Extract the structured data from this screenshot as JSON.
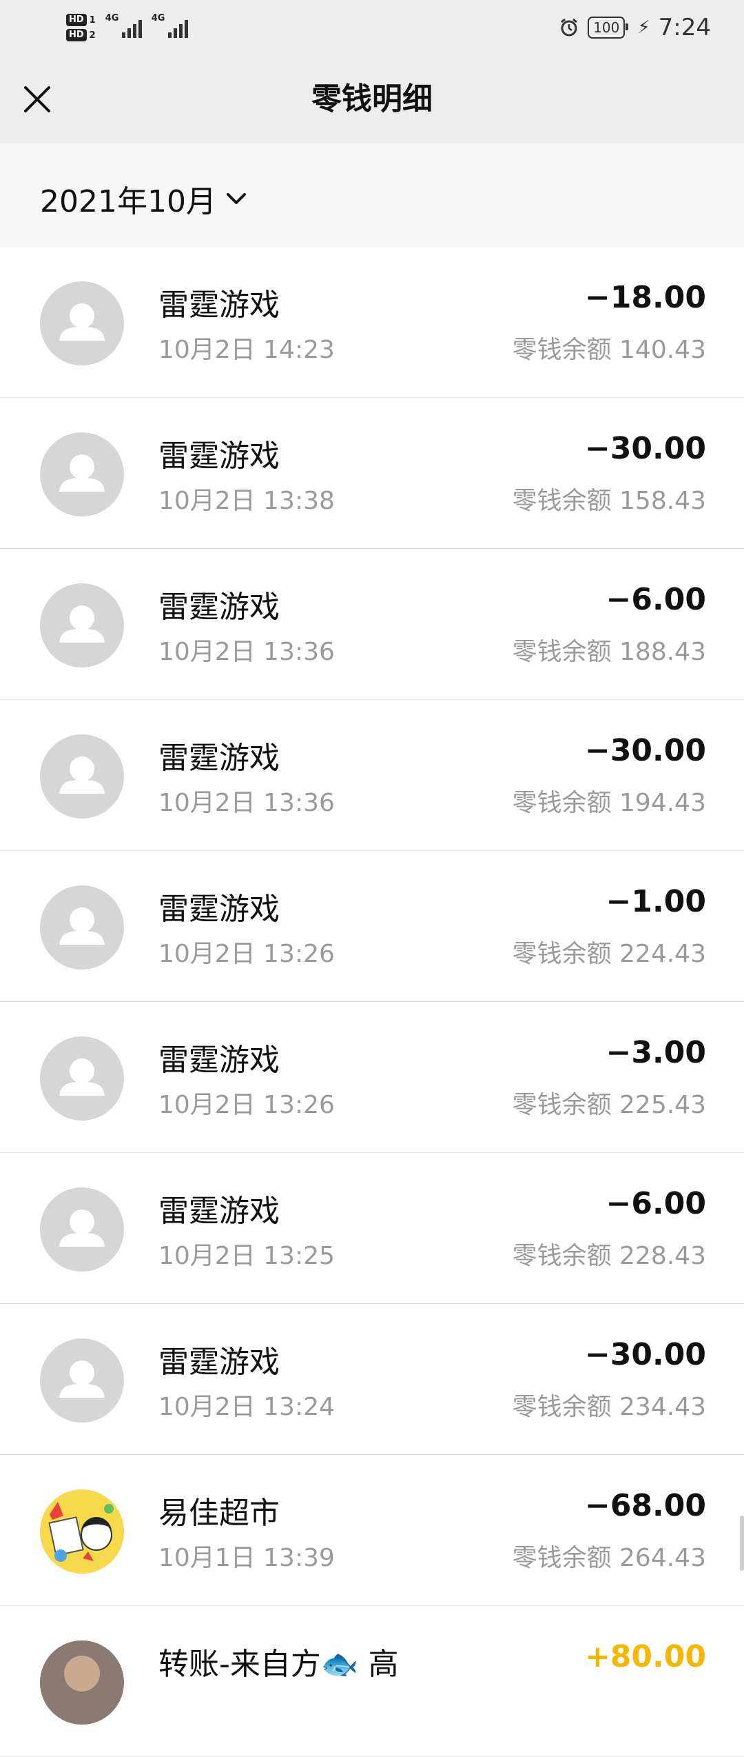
{
  "status_bar": {
    "sim1_badge": "HD",
    "sim1_num": "1",
    "sim2_badge": "HD",
    "sim2_num": "2",
    "network1": "4G",
    "network2": "4G",
    "battery": "100",
    "time": "7:24",
    "icons": [
      "alarm-icon",
      "battery-icon",
      "charging-icon"
    ]
  },
  "header": {
    "title": "零钱明细",
    "close_icon": "close-icon"
  },
  "filter": {
    "month": "2021年10月",
    "icon": "chevron-down-icon"
  },
  "transactions": [
    {
      "name": "雷霆游戏",
      "time": "10月2日 14:23",
      "amount": "−18.00",
      "balance": "零钱余额 140.43",
      "avatar": "default"
    },
    {
      "name": "雷霆游戏",
      "time": "10月2日 13:38",
      "amount": "−30.00",
      "balance": "零钱余额 158.43",
      "avatar": "default"
    },
    {
      "name": "雷霆游戏",
      "time": "10月2日 13:36",
      "amount": "−6.00",
      "balance": "零钱余额 188.43",
      "avatar": "default"
    },
    {
      "name": "雷霆游戏",
      "time": "10月2日 13:36",
      "amount": "−30.00",
      "balance": "零钱余额 194.43",
      "avatar": "default"
    },
    {
      "name": "雷霆游戏",
      "time": "10月2日 13:26",
      "amount": "−1.00",
      "balance": "零钱余额 224.43",
      "avatar": "default"
    },
    {
      "name": "雷霆游戏",
      "time": "10月2日 13:26",
      "amount": "−3.00",
      "balance": "零钱余额 225.43",
      "avatar": "default"
    },
    {
      "name": "雷霆游戏",
      "time": "10月2日 13:25",
      "amount": "−6.00",
      "balance": "零钱余额 228.43",
      "avatar": "default"
    },
    {
      "name": "雷霆游戏",
      "time": "10月2日 13:24",
      "amount": "−30.00",
      "balance": "零钱余额 234.43",
      "avatar": "default"
    },
    {
      "name": "易佳超市",
      "time": "10月1日 13:39",
      "amount": "−68.00",
      "balance": "零钱余额 264.43",
      "avatar": "store"
    },
    {
      "name": "转账-来自方🐟 高",
      "time": "",
      "amount": "+80.00",
      "balance": "",
      "avatar": "person"
    }
  ],
  "colors": {
    "header_bg": "#ededed",
    "filter_bg": "#f7f7f7",
    "positive_amount": "#f5b700",
    "secondary_text": "#9a9a9a"
  }
}
